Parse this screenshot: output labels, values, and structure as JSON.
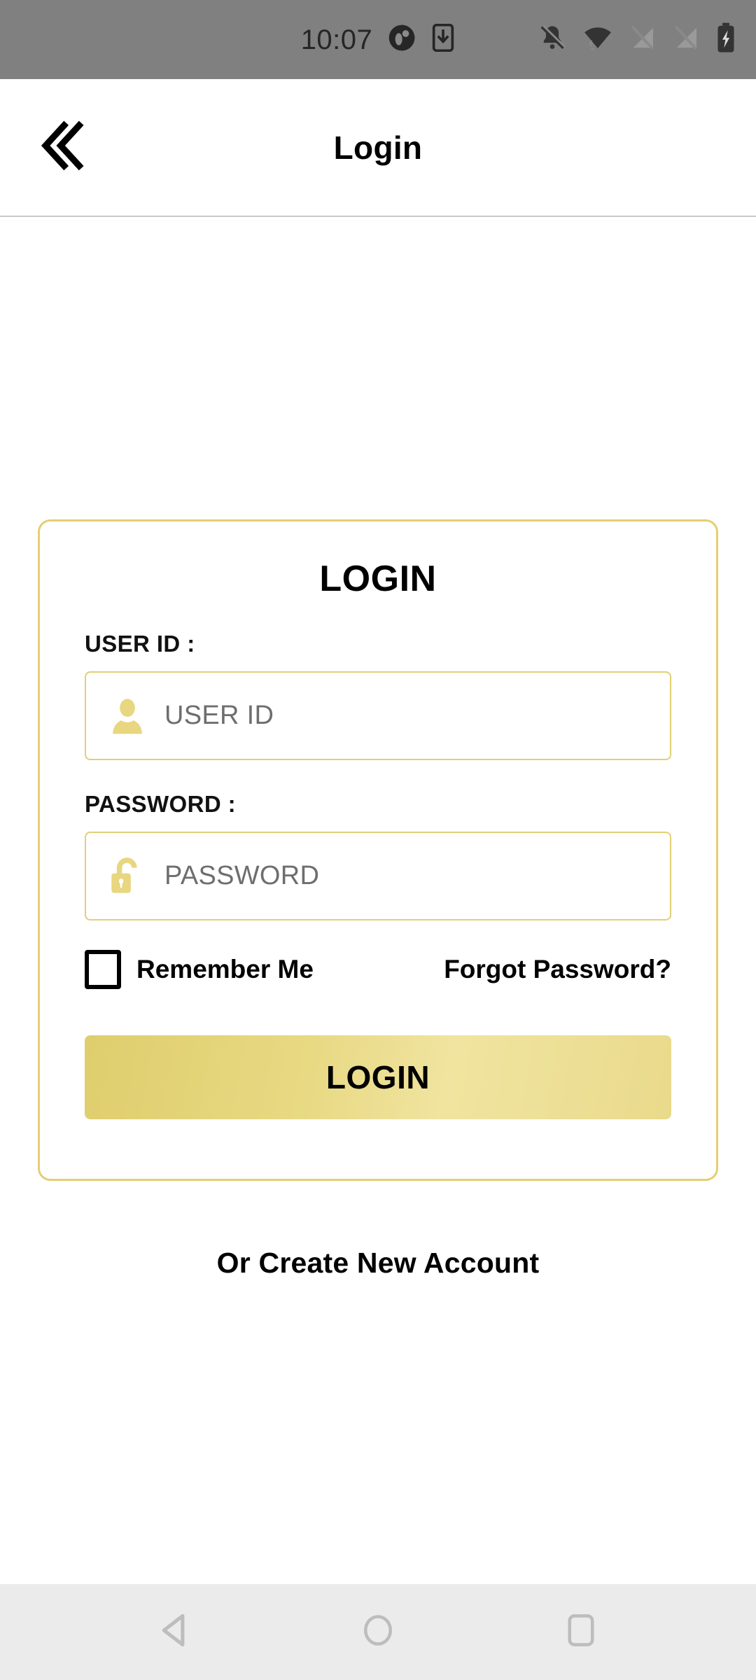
{
  "status_bar": {
    "time": "10:07",
    "background_color": "#808080",
    "icon_color": "#262626",
    "left_icons": [
      {
        "name": "do-not-disturb-icon",
        "label": "Do Not Disturb"
      },
      {
        "name": "download-to-device-icon",
        "label": "Download"
      }
    ],
    "right_icons": [
      {
        "name": "notifications-off-icon",
        "label": "Silent"
      },
      {
        "name": "wifi-icon",
        "label": "Wi-Fi"
      },
      {
        "name": "signal-off-sim1-icon",
        "label": "No SIM 1 signal"
      },
      {
        "name": "signal-off-sim2-icon",
        "label": "No SIM 2 signal"
      },
      {
        "name": "battery-charging-icon",
        "label": "Charging"
      }
    ]
  },
  "app_bar": {
    "title": "Login",
    "back_icon": "double-chevron-left-icon"
  },
  "card": {
    "heading": "LOGIN",
    "border_color": "#E2CF75",
    "fields": [
      {
        "label": "USER ID :",
        "placeholder": "USER ID",
        "value": "",
        "icon": "person-icon",
        "icon_color": "#E8D680"
      },
      {
        "label": "PASSWORD :",
        "placeholder": "PASSWORD",
        "value": "",
        "icon": "unlocked-padlock-icon",
        "icon_color": "#E8D680"
      }
    ],
    "remember_me": {
      "label": "Remember Me",
      "checked": false
    },
    "forgot_password": "Forgot Password?",
    "submit_button": {
      "label": "LOGIN",
      "gradient_from": "#DFCE6D",
      "gradient_to": "#E9DA8B",
      "text_color": "#000000"
    }
  },
  "create_account": "Or Create New Account",
  "nav_bar": {
    "background_color": "#EBEBEB",
    "icon_color": "#BDBDBD",
    "items": [
      {
        "name": "nav-back-button",
        "label": "Back",
        "icon": "triangle-back-icon"
      },
      {
        "name": "nav-home-button",
        "label": "Home",
        "icon": "circle-home-icon"
      },
      {
        "name": "nav-recents-button",
        "label": "Recents",
        "icon": "square-recents-icon"
      }
    ]
  }
}
